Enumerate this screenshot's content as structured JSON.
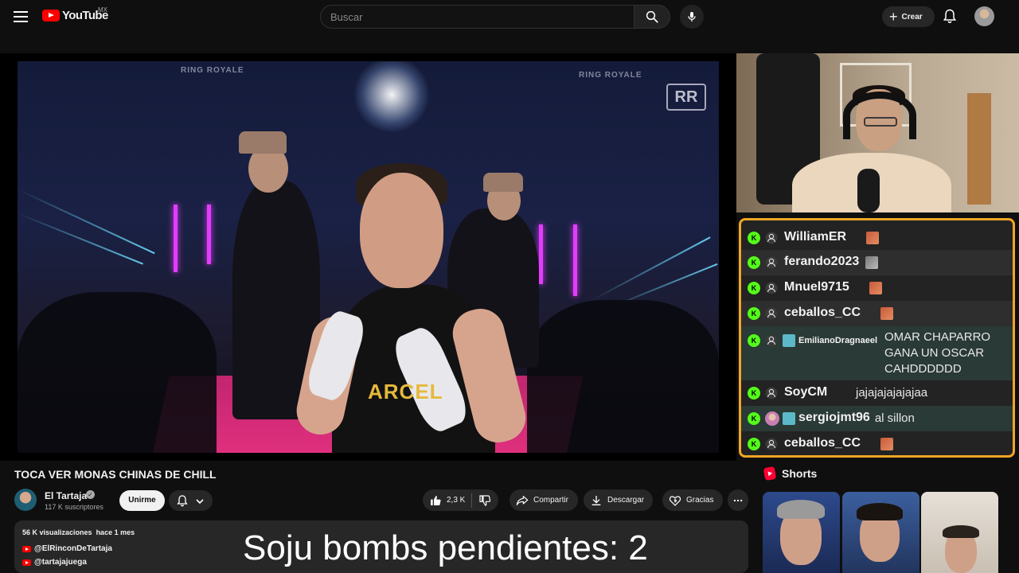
{
  "header": {
    "logo_text": "YouTube",
    "region": "MX",
    "search_placeholder": "Buscar",
    "create_label": "Crear"
  },
  "video": {
    "overlay_top_left": "RING ROYALE",
    "overlay_top_right": "RING ROYALE",
    "corner_logo": "RR",
    "shirt_text": "ARCEL"
  },
  "chat": {
    "messages": [
      {
        "user": "WilliamER",
        "text": "",
        "emote": true
      },
      {
        "user": "ferando2023",
        "text": "",
        "emote": true
      },
      {
        "user": "Mnuel9715",
        "text": "",
        "emote": true
      },
      {
        "user": "ceballos_CC",
        "text": "",
        "emote": true
      },
      {
        "user": "EmilianoDragnaeel",
        "text": "OMAR CHAPARRO GANA UN OSCAR CAHDDDDDD",
        "emote": false
      },
      {
        "user": "SoyCM",
        "text": "jajajajajajajaa",
        "emote": false
      },
      {
        "user": "sergiojmt96",
        "text": "al sillon",
        "emote": false
      },
      {
        "user": "ceballos_CC",
        "text": "",
        "emote": true
      }
    ]
  },
  "info": {
    "title": "TOCA VER MONAS CHINAS DE CHILL",
    "channel": "El Tartaja",
    "subscribers": "117 K suscriptores",
    "join_label": "Unirme",
    "likes": "2,3 K",
    "share_label": "Compartir",
    "download_label": "Descargar",
    "thanks_label": "Gracias"
  },
  "description": {
    "views": "56 K visualizaciones",
    "date": "hace 1 mes",
    "links": [
      "@ElRinconDeTartaja",
      "@tartajajuega"
    ]
  },
  "overlay_caption": "Soju bombs pendientes: 2",
  "shorts": {
    "title": "Shorts"
  },
  "colors": {
    "background": "#0f0f0f",
    "chat_border": "#f2a624",
    "kick_green": "#53fc18",
    "youtube_red": "#ff0000"
  }
}
